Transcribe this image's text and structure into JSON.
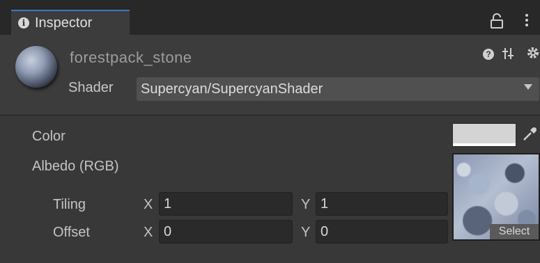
{
  "tab": {
    "label": "Inspector",
    "icon": "info-icon"
  },
  "toolbar": {
    "lock_icon": "lock-icon",
    "menu_icon": "vertical-ellipsis-icon"
  },
  "material": {
    "name": "forestpack_stone",
    "help_glyph": "?",
    "shader_label": "Shader",
    "shader_value": "Supercyan/SupercyanShader"
  },
  "properties": {
    "color_label": "Color",
    "color_value": "#d4d4d4",
    "albedo_label": "Albedo (RGB)",
    "select_label": "Select",
    "tiling_label": "Tiling",
    "offset_label": "Offset",
    "axis_x": "X",
    "axis_y": "Y",
    "tiling_x": "1",
    "tiling_y": "1",
    "offset_x": "0",
    "offset_y": "0"
  },
  "colors": {
    "background": "#383838",
    "tab_accent": "#3a79bb",
    "field": "#2a2a2a"
  }
}
